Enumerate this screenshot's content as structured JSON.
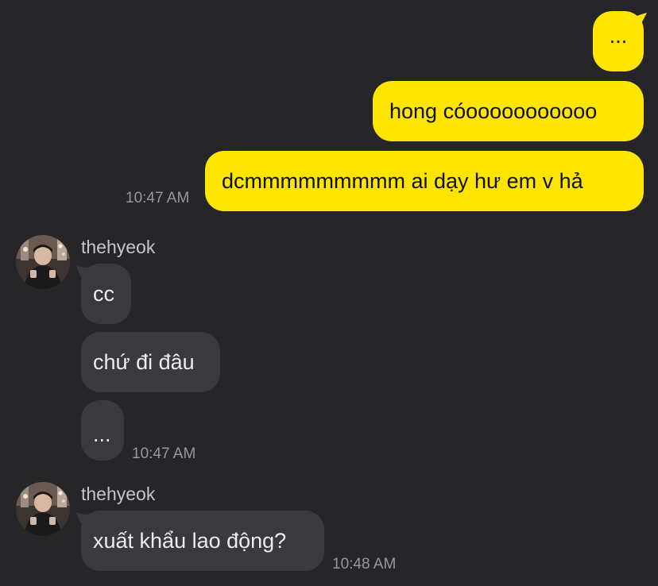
{
  "colors": {
    "background": "#262528",
    "outgoing_bubble": "#fee500",
    "incoming_bubble": "#3a393d",
    "timestamp": "#98979c"
  },
  "outgoing_group": {
    "messages": [
      {
        "text": "..."
      },
      {
        "text": "hong cóooooooooooo"
      },
      {
        "text": "dcmmmmmmmmm ai dạy hư em v hả"
      }
    ],
    "time": "10:47 AM"
  },
  "incoming_group_1": {
    "sender": "thehyeok",
    "avatar_icon": "profile-photo-icon",
    "messages": [
      {
        "text": "cc"
      },
      {
        "text": "chứ đi đâu"
      },
      {
        "text": "..."
      }
    ],
    "time": "10:47 AM"
  },
  "incoming_group_2": {
    "sender": "thehyeok",
    "avatar_icon": "profile-photo-icon",
    "messages": [
      {
        "text": "xuất khẩu lao động?"
      }
    ],
    "time": "10:48 AM"
  }
}
